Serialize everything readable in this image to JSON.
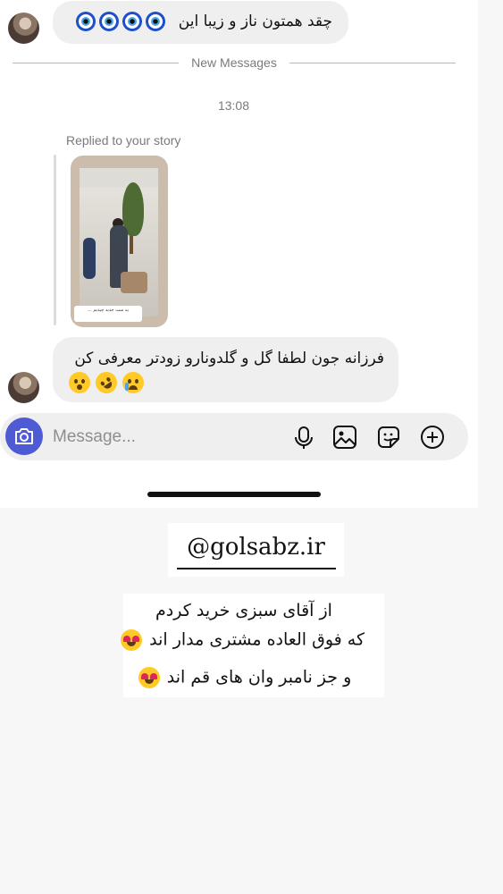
{
  "thread": {
    "top_message": "چقد همتون ناز و زیبا این",
    "divider_label": "New Messages",
    "timestamp": "13:08",
    "reply_label": "Replied to your story",
    "story_caption": "یه ست جدید چیدیم ...",
    "bottom_message": "فرزانه جون لطفا گل و گلدونارو زودتر معرفی کن"
  },
  "composer": {
    "placeholder": "Message..."
  },
  "overlay": {
    "handle": "@golsabz.ir",
    "note_line1": "از آقای سبزی خرید کردم",
    "note_line2": "که فوق العاده مشتری مدار اند",
    "note_line3": "و جز نامبر وان های قم اند"
  },
  "colors": {
    "bubble": "#efefef",
    "camera_button": "#4f5bd5",
    "evil_eye": "#1f4fc9",
    "muted_text": "#7a7a7a"
  },
  "icons": [
    "evil-eye-icon",
    "camera-icon",
    "microphone-icon",
    "image-icon",
    "sticker-icon",
    "plus-circle-icon",
    "face-blowing-kiss-icon",
    "rolling-laughing-icon",
    "crying-face-icon",
    "heart-eyes-icon"
  ]
}
